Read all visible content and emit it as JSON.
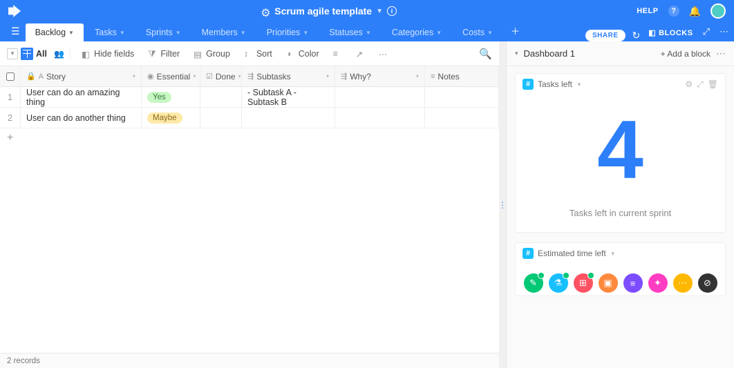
{
  "header": {
    "title": "Scrum agile template",
    "help": "HELP"
  },
  "tabs": [
    "Backlog",
    "Tasks",
    "Sprints",
    "Members",
    "Priorities",
    "Statuses",
    "Categories",
    "Costs"
  ],
  "active_tab": 0,
  "share": "SHARE",
  "blocks_label": "BLOCKS",
  "view": {
    "name": "All",
    "hide": "Hide fields",
    "filter": "Filter",
    "group": "Group",
    "sort": "Sort",
    "color": "Color"
  },
  "columns": {
    "story": "Story",
    "essential": "Essential",
    "done": "Done",
    "subtasks": "Subtasks",
    "why": "Why?",
    "notes": "Notes"
  },
  "rows": [
    {
      "n": "1",
      "story": "User can do an amazing thing",
      "essential": "Yes",
      "essential_class": "pill-yes",
      "done": "",
      "subtasks": "- Subtask A - Subtask B",
      "why": "",
      "notes": ""
    },
    {
      "n": "2",
      "story": "User can do another thing",
      "essential": "Maybe",
      "essential_class": "pill-maybe",
      "done": "",
      "subtasks": "",
      "why": "",
      "notes": ""
    }
  ],
  "footer": "2 records",
  "dashboard": {
    "title": "Dashboard 1",
    "add": "+ Add a block",
    "block1": {
      "title": "Tasks left",
      "value": "4",
      "caption": "Tasks left in current sprint"
    },
    "block2": {
      "title": "Estimated time left"
    }
  },
  "dot_colors": [
    "#00c875",
    "#18bfff",
    "#ff5263",
    "#ff8a3d",
    "#7c4dff",
    "#ff3dc2",
    "#ffb800",
    "#333333"
  ]
}
